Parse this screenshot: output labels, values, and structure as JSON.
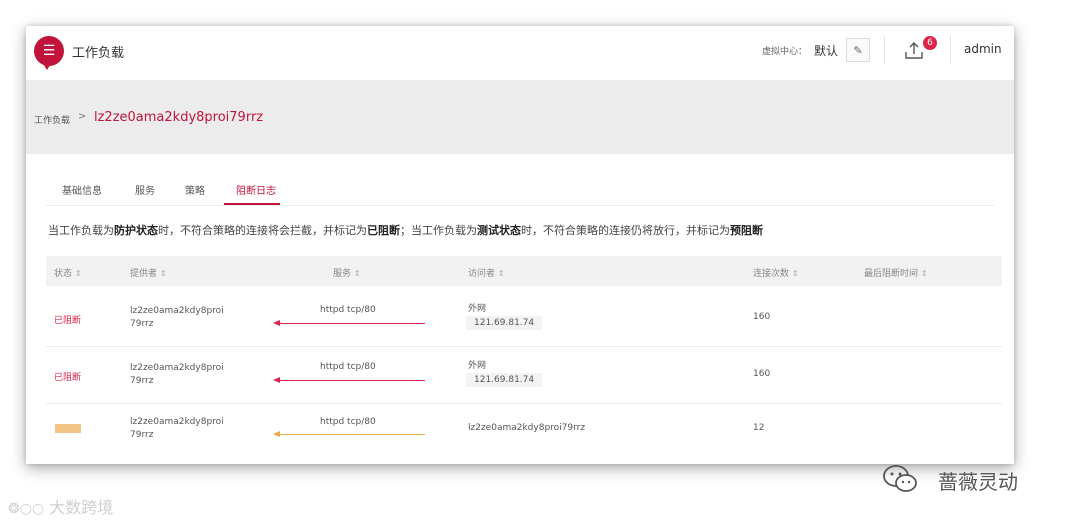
{
  "header": {
    "app_title": "工作负载",
    "vc_label": "虚拟中心：",
    "vc_value": "默认",
    "upload_badge": "6",
    "user": "admin"
  },
  "breadcrumb": {
    "parent": "工作负载",
    "separator": ">",
    "current": "lz2ze0ama2kdy8proi79rrz"
  },
  "tabs": [
    {
      "label": "基础信息",
      "active": false
    },
    {
      "label": "服务",
      "active": false
    },
    {
      "label": "策略",
      "active": false
    },
    {
      "label": "阻断日志",
      "active": true
    }
  ],
  "notice": {
    "p1": "当工作负载为",
    "b1": "防护状态",
    "p2": "时，不符合策略的连接将会拦截，并标记为",
    "b2": "已阻断",
    "p3": "；当工作负载为",
    "b3": "测试状态",
    "p4": "时，不符合策略的连接仍将放行，并标记为",
    "b4": "预阻断"
  },
  "table": {
    "columns": [
      "状态",
      "提供者",
      "服务",
      "访问者",
      "连接次数",
      "最后阻断时间"
    ],
    "rows": [
      {
        "status": "已阻断",
        "status_type": "blocked",
        "provider_line1": "lz2ze0ama2kdy8proi",
        "provider_line2": "79rrz",
        "service": "httpd tcp/80",
        "arrow_color": "#d9254b",
        "visitor_line1": "外网",
        "visitor_line2": "121.69.81.74",
        "count": "160",
        "time": ""
      },
      {
        "status": "已阻断",
        "status_type": "blocked",
        "provider_line1": "lz2ze0ama2kdy8proi",
        "provider_line2": "79rrz",
        "service": "httpd tcp/80",
        "arrow_color": "#d9254b",
        "visitor_line1": "外网",
        "visitor_line2": "121.69.81.74",
        "count": "160",
        "time": ""
      },
      {
        "status": "",
        "status_type": "pre-blocked",
        "provider_line1": "lz2ze0ama2kdy8proi",
        "provider_line2": "79rrz",
        "service": "httpd tcp/80",
        "arrow_color": "#e8a84c",
        "visitor_line1": "lz2ze0ama2kdy8proi79rrz",
        "visitor_line2": "",
        "count": "12",
        "time": ""
      }
    ]
  },
  "watermarks": {
    "left": "大数跨境",
    "right": "蔷薇灵动"
  },
  "colors": {
    "accent": "#c0143c",
    "blocked": "#d9254b",
    "pre_blocked": "#f3c486"
  }
}
